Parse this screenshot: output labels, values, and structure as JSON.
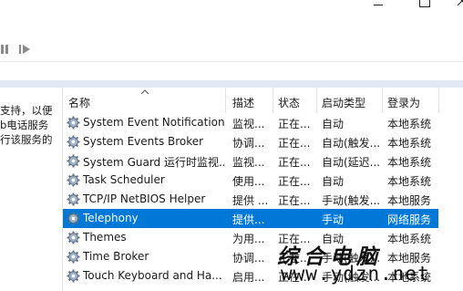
{
  "toolbar": {
    "pause_icon": "pause-icon",
    "restart_icon": "restart-icon"
  },
  "left_pane": {
    "description_lines": [
      "支持，以便",
      "b电话服务",
      "行该服务的"
    ]
  },
  "table": {
    "headers": {
      "name": "名称",
      "description": "描述",
      "status": "状态",
      "startup": "启动类型",
      "logon": "登录为"
    },
    "rows": [
      {
        "name": "System Event Notification...",
        "description": "监视...",
        "status": "正在...",
        "startup": "自动",
        "logon": "本地系统",
        "selected": false
      },
      {
        "name": "System Events Broker",
        "description": "协调...",
        "status": "正在...",
        "startup": "自动(触发...",
        "logon": "本地系统",
        "selected": false
      },
      {
        "name": "System Guard 运行时监视...",
        "description": "监视...",
        "status": "正在...",
        "startup": "自动(延迟...",
        "logon": "本地系统",
        "selected": false
      },
      {
        "name": "Task Scheduler",
        "description": "使用...",
        "status": "正在...",
        "startup": "自动",
        "logon": "本地系统",
        "selected": false
      },
      {
        "name": "TCP/IP NetBIOS Helper",
        "description": "提供 ...",
        "status": "正在...",
        "startup": "手动(触发...",
        "logon": "本地服务",
        "selected": false
      },
      {
        "name": "Telephony",
        "description": "提供...",
        "status": "",
        "startup": "手动",
        "logon": "网络服务",
        "selected": true
      },
      {
        "name": "Themes",
        "description": "为用...",
        "status": "正在...",
        "startup": "自动",
        "logon": "本地系统",
        "selected": false
      },
      {
        "name": "Time Broker",
        "description": "协调...",
        "status": "正在...",
        "startup": "手动(触发...",
        "logon": "本地服务",
        "selected": false
      },
      {
        "name": "Touch Keyboard and Ha...",
        "description": "启用...",
        "status": "正在...",
        "startup": "手动(触发...",
        "logon": "本地系统",
        "selected": false
      }
    ]
  },
  "watermark": {
    "title": "综合电脑",
    "url": "www.ydzn.net"
  }
}
